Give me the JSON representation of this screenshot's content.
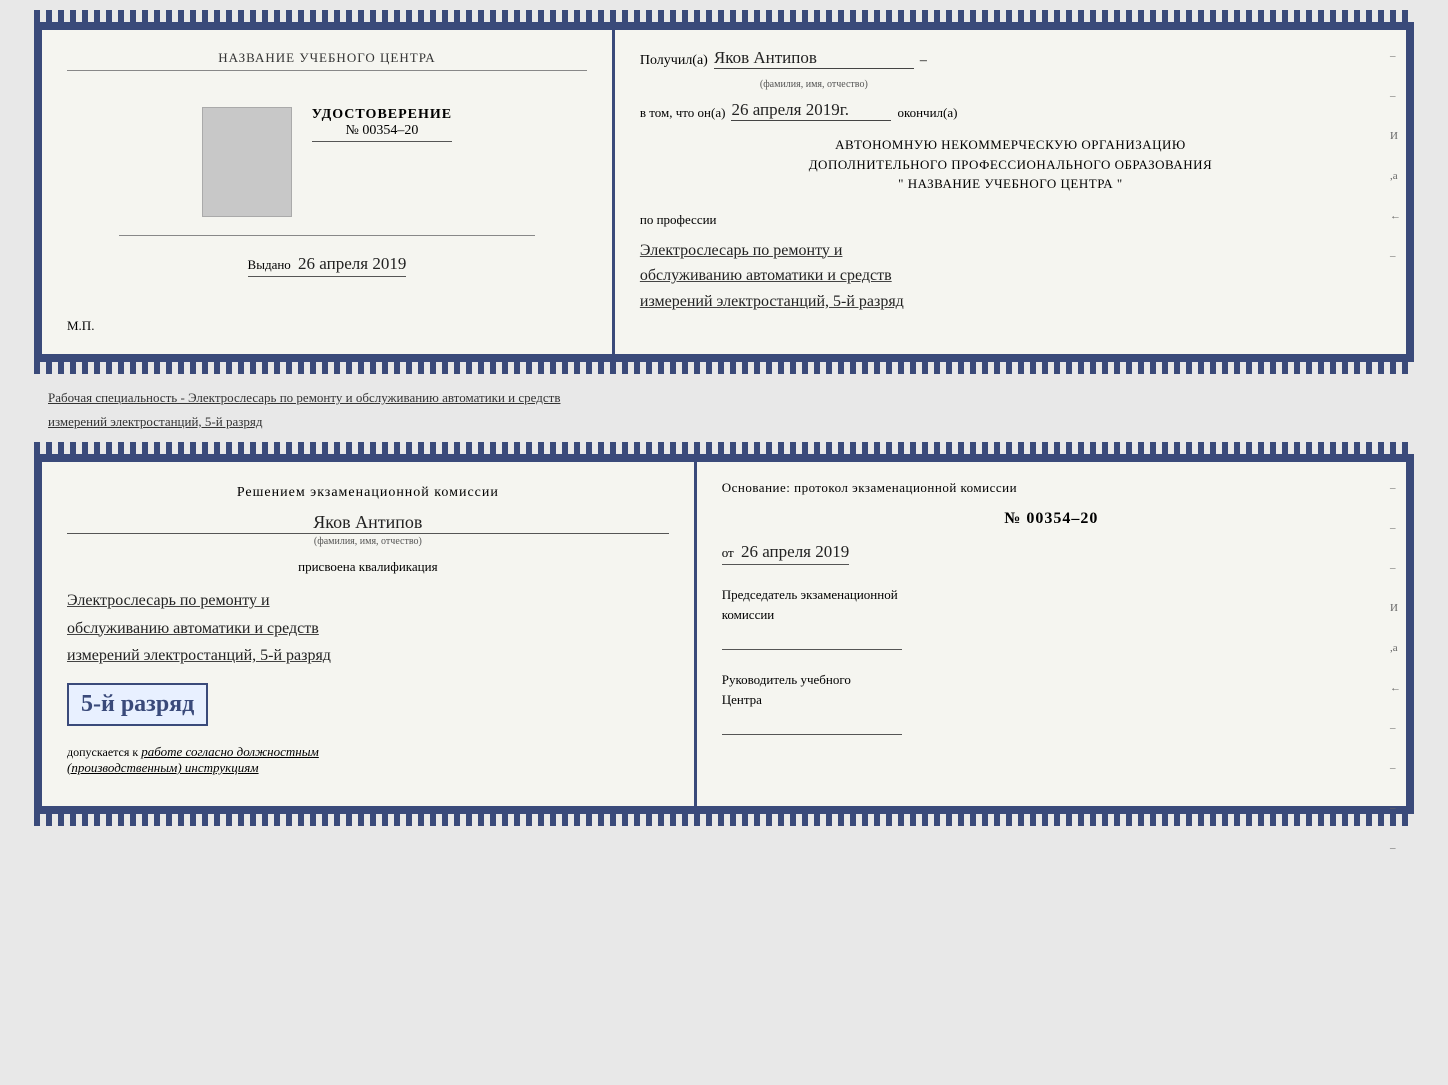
{
  "diploma": {
    "left": {
      "center_name": "НАЗВАНИЕ УЧЕБНОГО ЦЕНТРА",
      "udost_title": "УДОСТОВЕРЕНИЕ",
      "udost_number": "№ 00354–20",
      "vydano_label": "Выдано",
      "vydano_date": "26 апреля 2019",
      "mp_label": "М.П."
    },
    "right": {
      "poluchil_label": "Получил(а)",
      "recipient_name": "Яков Антипов",
      "fio_caption": "(фамилия, имя, отчество)",
      "vtom_label": "в том, что он(а)",
      "vtom_date": "26 апреля 2019г.",
      "okonchil_label": "окончил(а)",
      "ano_line1": "АВТОНОМНУЮ НЕКОММЕРЧЕСКУЮ ОРГАНИЗАЦИЮ",
      "ano_line2": "ДОПОЛНИТЕЛЬНОГО ПРОФЕССИОНАЛЬНОГО ОБРАЗОВАНИЯ",
      "ano_line3": "\"   НАЗВАНИЕ УЧЕБНОГО ЦЕНТРА   \"",
      "po_professii_label": "по профессии",
      "profession_line1": "Электрослесарь по ремонту и",
      "profession_line2": "обслуживанию автоматики и средств",
      "profession_line3": "измерений электростанций, 5-й разряд"
    }
  },
  "specialty_text": "Рабочая специальность - Электрослесарь по ремонту и обслуживанию автоматики и средств",
  "specialty_text2": "измерений электростанций, 5-й разряд",
  "qualification": {
    "left": {
      "resheniem_label": "Решением экзаменационной комиссии",
      "fio": "Яков Антипов",
      "fio_caption": "(фамилия, имя, отчество)",
      "prisvоena_label": "присвоена квалификация",
      "prof_line1": "Электрослесарь по ремонту и",
      "prof_line2": "обслуживанию автоматики и средств",
      "prof_line3": "измерений электростанций, 5-й разряд",
      "big_rank": "5-й разряд",
      "dopuskaetsya_label": "допускается к",
      "dopuskaetsya_text": "работе согласно должностным",
      "dopuskaetsya_text2": "(производственным) инструкциям"
    },
    "right": {
      "osnovanie_label": "Основание: протокол экзаменационной комиссии",
      "protokol_number": "№  00354–20",
      "ot_label": "от",
      "ot_date": "26 апреля 2019",
      "chairman_label": "Председатель экзаменационной",
      "chairman_label2": "комиссии",
      "rukov_label": "Руководитель учебного",
      "rukov_label2": "Центра"
    }
  },
  "side_marks": [
    "И",
    "а",
    "←",
    "–",
    "–",
    "–"
  ]
}
